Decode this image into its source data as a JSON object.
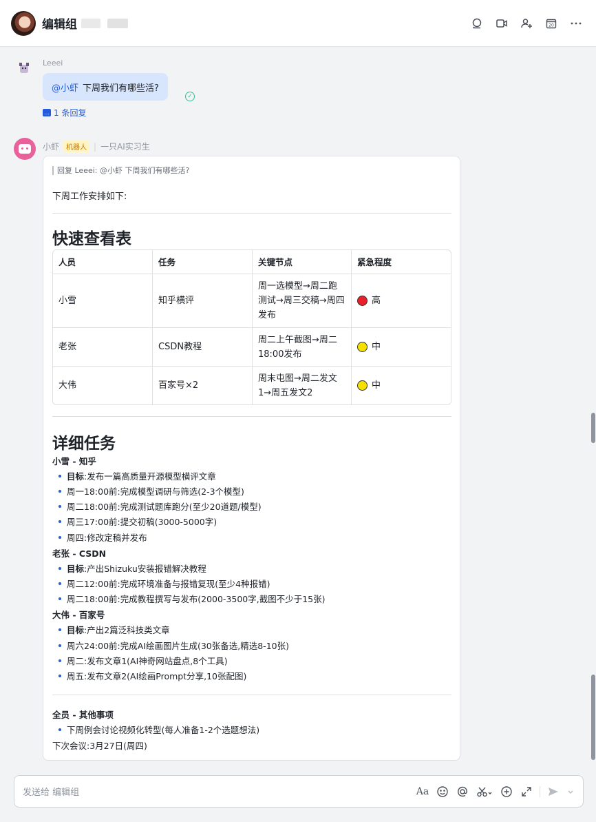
{
  "header": {
    "title": "编辑组",
    "icons": [
      "search-chat-icon",
      "video-call-icon",
      "add-member-icon",
      "calendar-icon",
      "more-icon"
    ],
    "calendar_day": "20"
  },
  "message1": {
    "sender": "Leeei",
    "mention": "@小虾",
    "text": "下周我们有哪些活?",
    "reply_count": "1 条回复"
  },
  "message2": {
    "sender": "小虾",
    "tag": "机器人",
    "description": "一只AI实习生",
    "quote": "回复 Leeei: @小虾 下周我们有哪些活?",
    "intro": "下周工作安排如下:",
    "overview_title": "快速查看表",
    "table": {
      "headers": [
        "人员",
        "任务",
        "关键节点",
        "紧急程度"
      ],
      "rows": [
        {
          "person": "小雪",
          "task": "知乎横评",
          "milestones": "周一选模型→周二跑测试→周三交稿→周四发布",
          "urgency": "高",
          "urgency_color": "#e8202a"
        },
        {
          "person": "老张",
          "task": "CSDN教程",
          "milestones": "周二上午截图→周二18:00发布",
          "urgency": "中",
          "urgency_color": "#f5e100"
        },
        {
          "person": "大伟",
          "task": "百家号×2",
          "milestones": "周末屯图→周二发文1→周五发文2",
          "urgency": "中",
          "urgency_color": "#f5e100"
        }
      ]
    },
    "detail_title": "详细任务",
    "sections": [
      {
        "heading": "小雪 - 知乎",
        "goal_label": "目标",
        "goal": ":发布一篇高质量开源模型横评文章",
        "items": [
          "周一18:00前:完成模型调研与筛选(2-3个模型)",
          "周二18:00前:完成测试题库跑分(至少20道题/模型)",
          "周三17:00前:提交初稿(3000-5000字)",
          "周四:修改定稿并发布"
        ]
      },
      {
        "heading": "老张 - CSDN",
        "goal_label": "目标",
        "goal": ":产出Shizuku安装报错解决教程",
        "items": [
          "周二12:00前:完成环境准备与报错复现(至少4种报错)",
          "周二18:00前:完成教程撰写与发布(2000-3500字,截图不少于15张)"
        ]
      },
      {
        "heading": "大伟 - 百家号",
        "goal_label": "目标",
        "goal": ":产出2篇泛科技类文章",
        "items": [
          "周六24:00前:完成AI绘画图片生成(30张备选,精选8-10张)",
          "周二:发布文章1(AI神奇网站盘点,8个工具)",
          "周五:发布文章2(AI绘画Prompt分享,10张配图)"
        ]
      }
    ],
    "others_heading": "全员 - 其他事项",
    "others_item": "下周例会讨论视频化转型(每人准备1-2个选题想法)",
    "next_meeting": "下次会议:3月27日(周四)"
  },
  "composer": {
    "placeholder": "发送给 编辑组",
    "format_label": "Aa"
  }
}
